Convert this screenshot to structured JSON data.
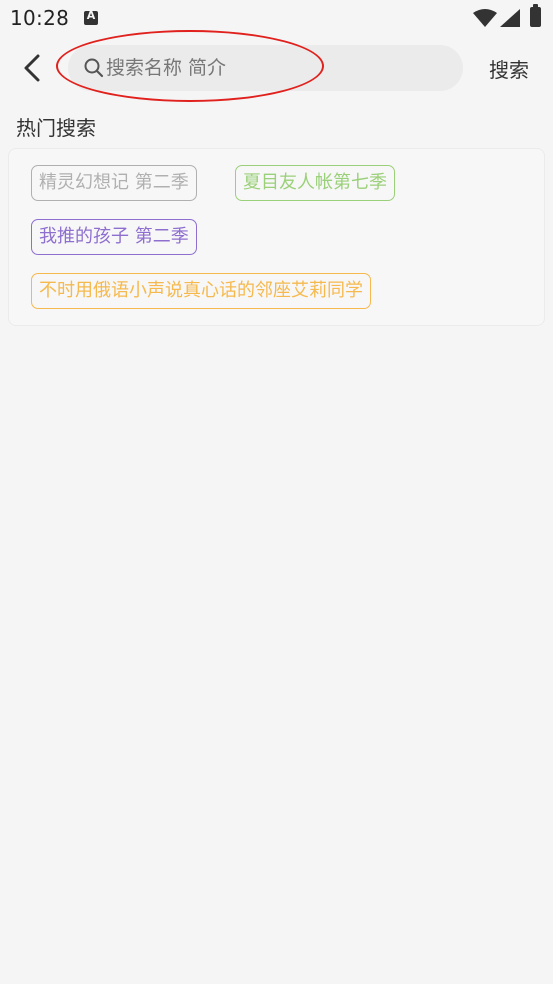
{
  "status_bar": {
    "time": "10:28",
    "app_icon_letter": "A",
    "icons": [
      "wifi-icon",
      "signal-icon",
      "battery-icon"
    ]
  },
  "header": {
    "back_icon": "chevron-left-icon",
    "search_icon": "search-icon",
    "search_placeholder": "搜索名称 简介",
    "search_value": "",
    "search_button_label": "搜索"
  },
  "annotation": {
    "ellipse_color": "#e0211d"
  },
  "hot_search": {
    "title": "热门搜索",
    "tags": [
      {
        "label": "精灵幻想记 第二季",
        "color": "#b0b0b0"
      },
      {
        "label": "夏目友人帐第七季",
        "color": "#9bd07a"
      },
      {
        "label": "我推的孩子 第二季",
        "color": "#8e6fcf"
      },
      {
        "label": "不时用俄语小声说真心话的邻座艾莉同学",
        "color": "#f6b94e"
      }
    ]
  }
}
